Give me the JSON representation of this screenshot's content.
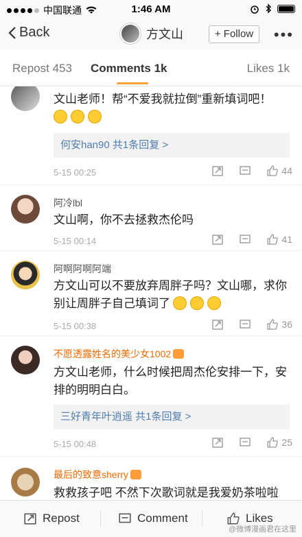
{
  "status_bar": {
    "carrier": "中国联通",
    "time": "1:46 AM"
  },
  "nav": {
    "back_label": "Back",
    "user_name": "方文山",
    "follow_label": "+ Follow",
    "more_label": "•••"
  },
  "tabs": [
    {
      "label": "Repost 453"
    },
    {
      "label": "Comments 1k"
    },
    {
      "label": "Likes 1k"
    }
  ],
  "comments": [
    {
      "author": "",
      "text": "文山老师！帮“不爱我就拉倒”重新填词吧！",
      "reply_link": "何安han90 共1条回复 >",
      "time": "5-15 00:25",
      "likes": "44"
    },
    {
      "author": "阿冷lbl",
      "text": "文山啊，你不去拯救杰伦吗",
      "time": "5-15 00:14",
      "likes": "41"
    },
    {
      "author": "阿啊阿啊阿端",
      "text": "方文山可以不要放弃周胖子吗？文山哪，求你别让周胖子自己填词了",
      "time": "5-15 00:38",
      "likes": "36"
    },
    {
      "author": "不愿透露姓名的美少女1002",
      "text": "方文山老师，什么时候把周杰伦安排一下，安排的明明白白。",
      "reply_link": "三好青年叶逍遥 共1条回复 >",
      "time": "5-15 00:48",
      "likes": "25"
    },
    {
      "author": "最后的致意sherry",
      "text": "救救孩子吧  不然下次歌词就是我爱奶茶啦啦"
    }
  ],
  "bottom_bar": {
    "repost_label": "Repost",
    "comment_label": "Comment",
    "likes_label": "Likes",
    "watermark": "@微博漫画君在这里"
  },
  "colors": {
    "accent": "#f7a136",
    "link": "#507daf",
    "vip_name": "#f06a00"
  }
}
